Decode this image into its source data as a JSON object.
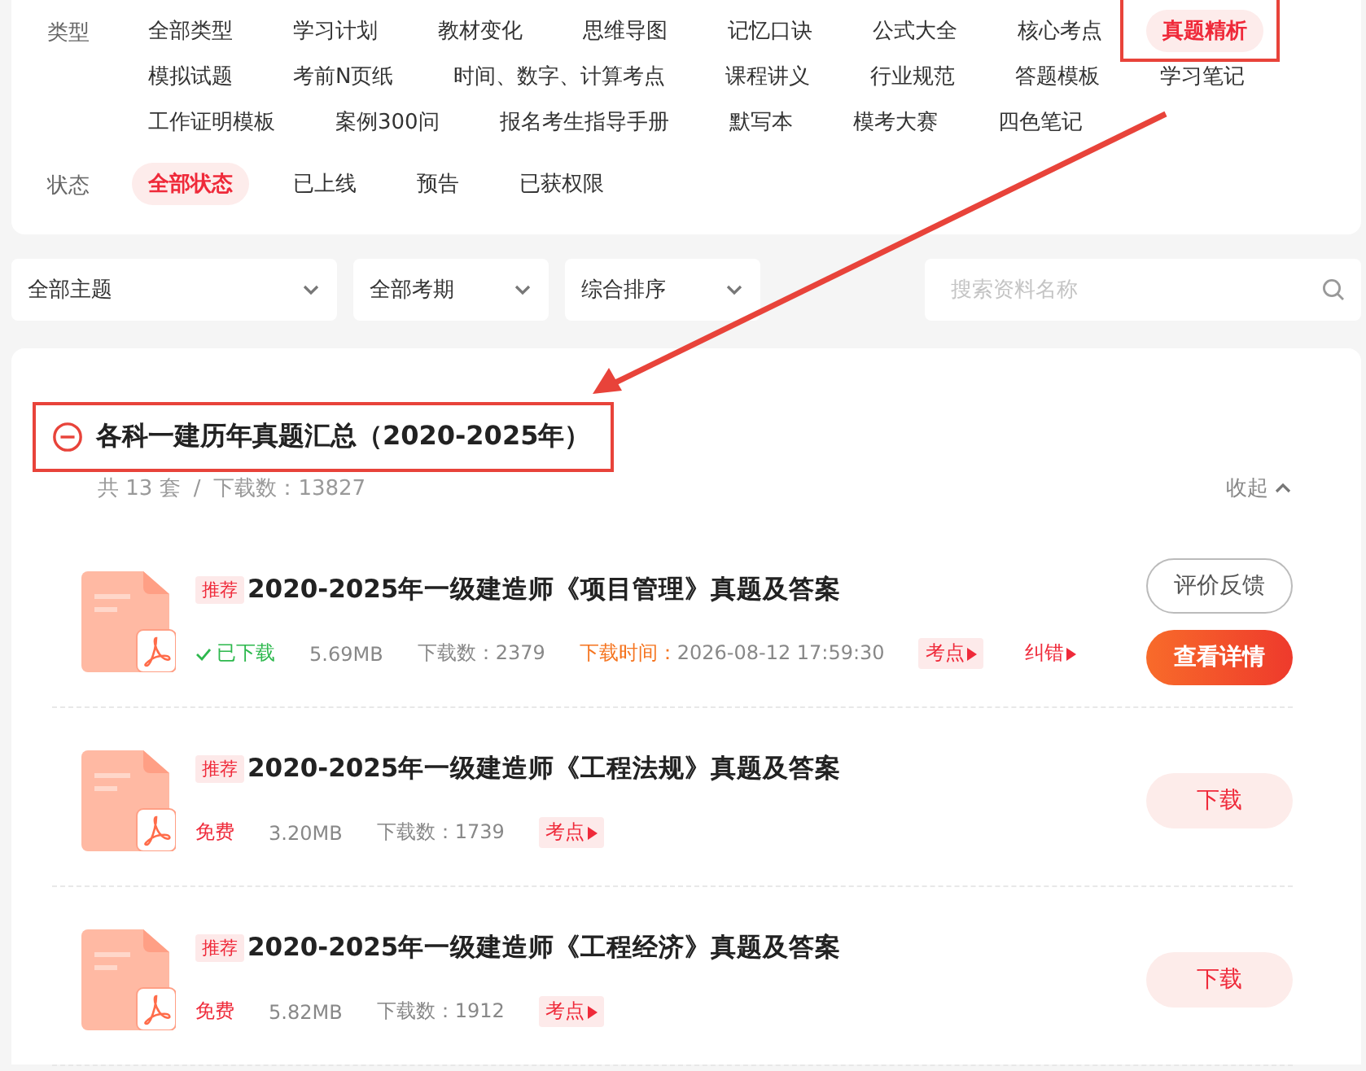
{
  "filters": {
    "type": {
      "label": "类型",
      "options": [
        {
          "label": "全部类型",
          "selected": false,
          "highlighted": false
        },
        {
          "label": "学习计划",
          "selected": false,
          "highlighted": false
        },
        {
          "label": "教材变化",
          "selected": false,
          "highlighted": false
        },
        {
          "label": "思维导图",
          "selected": false,
          "highlighted": false
        },
        {
          "label": "记忆口诀",
          "selected": false,
          "highlighted": false
        },
        {
          "label": "公式大全",
          "selected": false,
          "highlighted": false
        },
        {
          "label": "核心考点",
          "selected": false,
          "highlighted": false
        },
        {
          "label": "真题精析",
          "selected": true,
          "highlighted": true
        },
        {
          "label": "模拟试题",
          "selected": false,
          "highlighted": false
        },
        {
          "label": "考前N页纸",
          "selected": false,
          "highlighted": false
        },
        {
          "label": "时间、数字、计算考点",
          "selected": false,
          "highlighted": false
        },
        {
          "label": "课程讲义",
          "selected": false,
          "highlighted": false
        },
        {
          "label": "行业规范",
          "selected": false,
          "highlighted": false
        },
        {
          "label": "答题模板",
          "selected": false,
          "highlighted": false
        },
        {
          "label": "学习笔记",
          "selected": false,
          "highlighted": false
        },
        {
          "label": "工作证明模板",
          "selected": false,
          "highlighted": false
        },
        {
          "label": "案例300问",
          "selected": false,
          "highlighted": false
        },
        {
          "label": "报名考生指导手册",
          "selected": false,
          "highlighted": false
        },
        {
          "label": "默写本",
          "selected": false,
          "highlighted": false
        },
        {
          "label": "模考大赛",
          "selected": false,
          "highlighted": false
        },
        {
          "label": "四色笔记",
          "selected": false,
          "highlighted": false
        }
      ]
    },
    "status": {
      "label": "状态",
      "options": [
        {
          "label": "全部状态",
          "selected": true,
          "highlighted": false
        },
        {
          "label": "已上线",
          "selected": false,
          "highlighted": false
        },
        {
          "label": "预告",
          "selected": false,
          "highlighted": false
        },
        {
          "label": "已获权限",
          "selected": false,
          "highlighted": false
        }
      ]
    }
  },
  "toolbar": {
    "selects": [
      "全部主题",
      "全部考期",
      "综合排序"
    ],
    "search": {
      "placeholder": "搜索资料名称"
    }
  },
  "group": {
    "title": "各科一建历年真题汇总（2020-2025年）",
    "highlighted": true,
    "expanded": true,
    "count": "共 13 套",
    "separator": "/",
    "downloads": "下载数：13827",
    "collapse_label": "收起",
    "items": [
      {
        "badge": "推荐",
        "title": "2020-2025年一级建造师《项目管理》真题及答案",
        "status": {
          "kind": "downloaded",
          "text": "已下载"
        },
        "size": "5.69MB",
        "downloads": "下载数：2379",
        "time_label": "下载时间：",
        "time": "2026-08-12 17:59:30",
        "tags": [
          {
            "kind": "filled",
            "label": "考点"
          },
          {
            "kind": "plain",
            "label": "纠错"
          }
        ],
        "actions": [
          {
            "kind": "outline",
            "label": "评价反馈"
          },
          {
            "kind": "primary",
            "label": "查看详情"
          }
        ]
      },
      {
        "badge": "推荐",
        "title": "2020-2025年一级建造师《工程法规》真题及答案",
        "status": {
          "kind": "free",
          "text": "免费"
        },
        "size": "3.20MB",
        "downloads": "下载数：1739",
        "tags": [
          {
            "kind": "filled",
            "label": "考点"
          }
        ],
        "actions": [
          {
            "kind": "soft",
            "label": "下载"
          }
        ]
      },
      {
        "badge": "推荐",
        "title": "2020-2025年一级建造师《工程经济》真题及答案",
        "status": {
          "kind": "free",
          "text": "免费"
        },
        "size": "5.82MB",
        "downloads": "下载数：1912",
        "tags": [
          {
            "kind": "filled",
            "label": "考点"
          }
        ],
        "actions": [
          {
            "kind": "soft",
            "label": "下载"
          }
        ]
      }
    ]
  }
}
